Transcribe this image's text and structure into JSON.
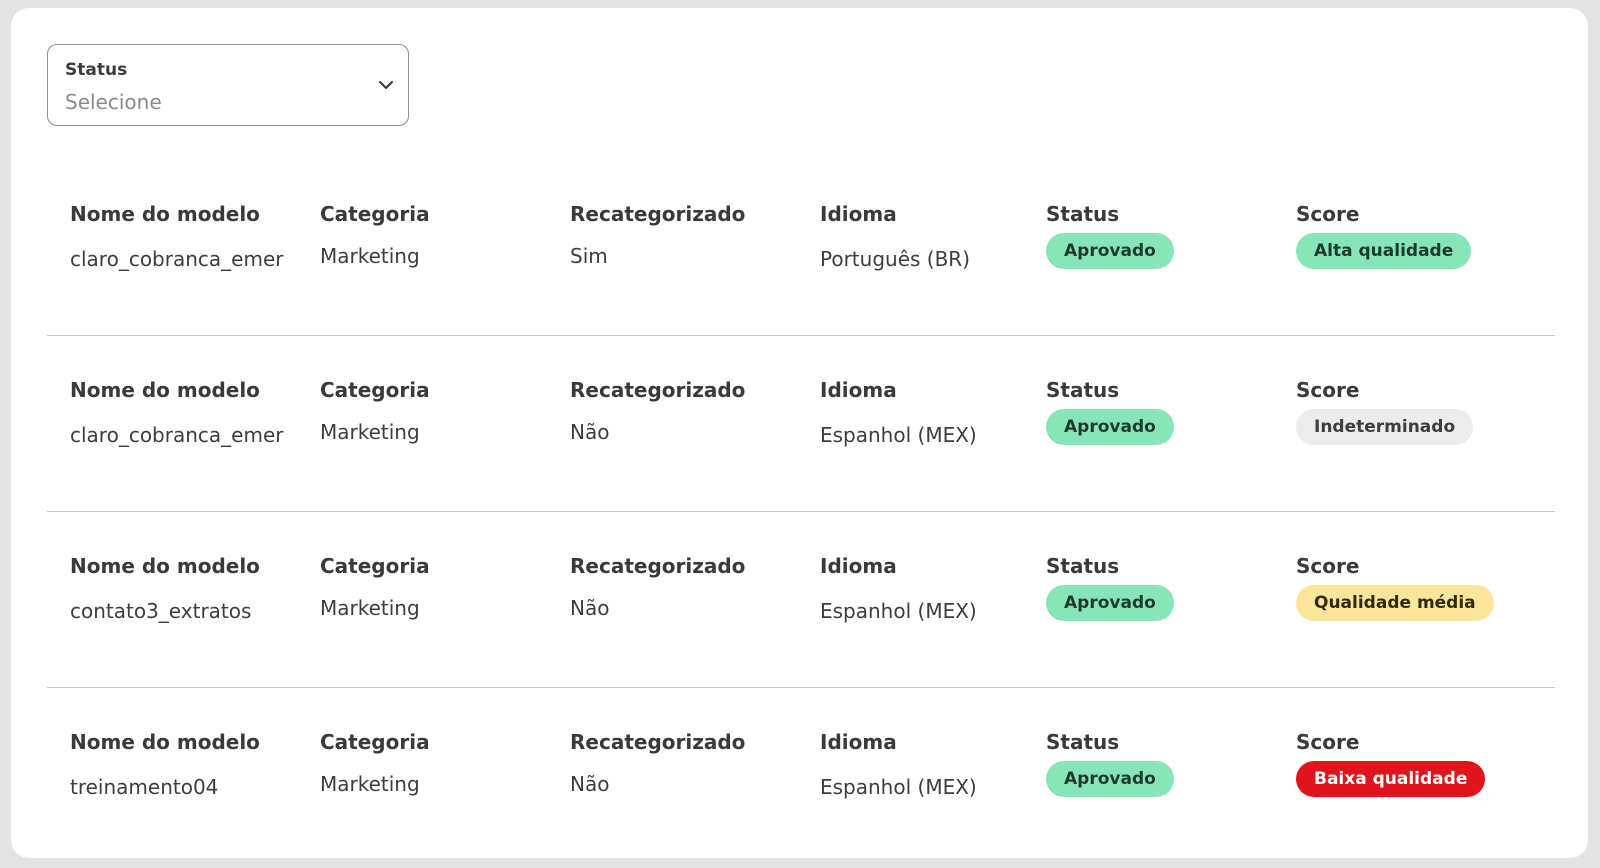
{
  "filter": {
    "label": "Status",
    "placeholder": "Selecione",
    "icon": "chevron-down-icon"
  },
  "columns": [
    "Nome do modelo",
    "Categoria",
    "Recategorizado",
    "Idioma",
    "Status",
    "Score"
  ],
  "rows": [
    {
      "name": "claro_cobranca_emer",
      "category": "Marketing",
      "recategorized": "Sim",
      "language": "Português (BR)",
      "status": "Aprovado",
      "score": "Alta qualidade"
    },
    {
      "name": "claro_cobranca_emer",
      "category": "Marketing",
      "recategorized": "Não",
      "language": "Espanhol (MEX)",
      "status": "Aprovado",
      "score": "Indeterminado"
    },
    {
      "name": "contato3_extratos",
      "category": "Marketing",
      "recategorized": "Não",
      "language": "Espanhol (MEX)",
      "status": "Aprovado",
      "score": "Qualidade média"
    },
    {
      "name": "treinamento04",
      "category": "Marketing",
      "recategorized": "Não",
      "language": "Espanhol (MEX)",
      "status": "Aprovado",
      "score": "Baixa qualidade"
    }
  ],
  "colors": {
    "approved_bg": "#86e6b8",
    "approved_fg": "#1f3a2c",
    "high_bg": "#86e6b8",
    "high_fg": "#1f3a2c",
    "undetermined_bg": "#ececec",
    "undetermined_fg": "#3d3d3d",
    "medium_bg": "#fbe59b",
    "medium_fg": "#2f2a10",
    "low_bg": "#e0141c",
    "low_fg": "#ffffff"
  }
}
